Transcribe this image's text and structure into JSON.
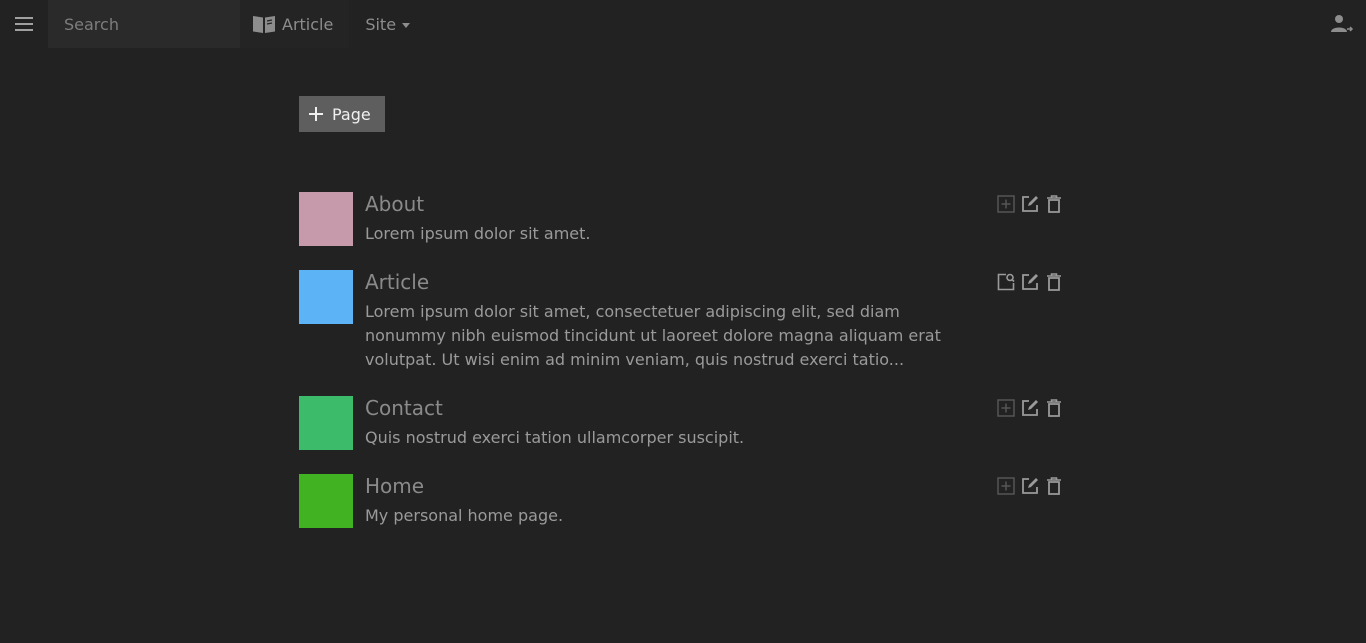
{
  "topbar": {
    "search_placeholder": "Search",
    "article_label": "Article",
    "site_label": "Site"
  },
  "toolbar": {
    "add_page_label": "Page"
  },
  "pages": [
    {
      "title": "About",
      "description": "Lorem ipsum dolor sit amet.",
      "color": "#c79aab",
      "first_action_icon": "add-box-icon"
    },
    {
      "title": "Article",
      "description": "Lorem ipsum dolor sit amet, consectetuer adipiscing elit, sed diam nonummy nibh euismod tincidunt ut laoreet dolore magna aliquam erat volutpat. Ut wisi enim ad minim veniam, quis nostrud exerci tatio...",
      "color": "#5cb4f6",
      "first_action_icon": "page-search-icon"
    },
    {
      "title": "Contact",
      "description": "Quis nostrud exerci tation ullamcorper suscipit.",
      "color": "#3cbb6b",
      "first_action_icon": "add-box-icon"
    },
    {
      "title": "Home",
      "description": "My personal home page.",
      "color": "#41b322",
      "first_action_icon": "add-box-icon"
    }
  ],
  "colors": {
    "background": "#222222",
    "add_button_bg": "#5e5e5e",
    "search_bg": "#2a2a2a"
  }
}
